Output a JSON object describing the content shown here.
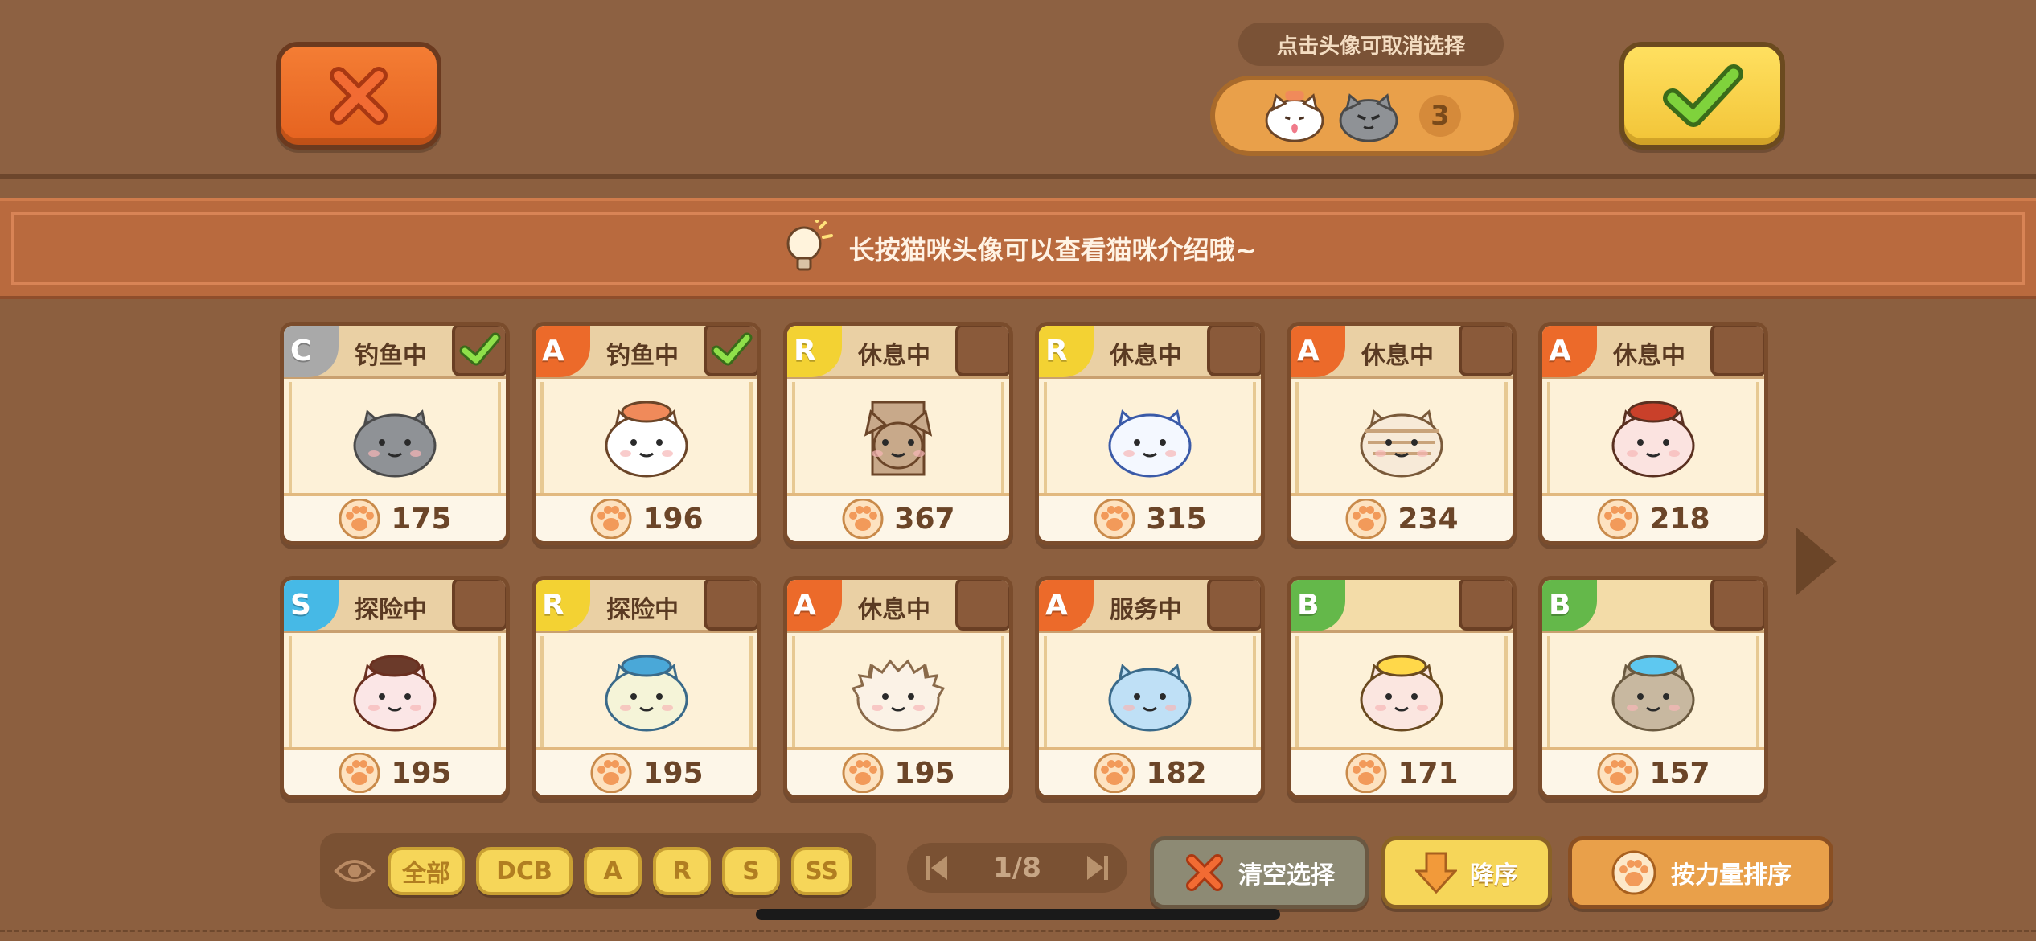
{
  "header": {
    "cancel_hint": "点击头像可取消选择",
    "selected_count": "3"
  },
  "tip": {
    "text": "长按猫咪头像可以查看猫咪介绍哦~"
  },
  "rank_colors": {
    "C": "#a9a9a9",
    "A": "#ec6a2a",
    "R": "#f3d233",
    "S": "#46b9e6",
    "B": "#64b84a"
  },
  "cats": [
    {
      "rank": "C",
      "status": "钓鱼中",
      "power": "175",
      "selected": true,
      "cat": "grey-cat"
    },
    {
      "rank": "A",
      "status": "钓鱼中",
      "power": "196",
      "selected": true,
      "cat": "white-sushi-cat"
    },
    {
      "rank": "R",
      "status": "休息中",
      "power": "367",
      "selected": false,
      "cat": "paper-bag-cat"
    },
    {
      "rank": "R",
      "status": "休息中",
      "power": "315",
      "selected": false,
      "cat": "blue-white-cat"
    },
    {
      "rank": "A",
      "status": "休息中",
      "power": "234",
      "selected": false,
      "cat": "mummy-cat"
    },
    {
      "rank": "A",
      "status": "休息中",
      "power": "218",
      "selected": false,
      "cat": "red-hat-cat"
    },
    {
      "rank": "S",
      "status": "探险中",
      "power": "195",
      "selected": false,
      "cat": "golden-horn-cat"
    },
    {
      "rank": "R",
      "status": "探险中",
      "power": "195",
      "selected": false,
      "cat": "taptap-hat-cat"
    },
    {
      "rank": "A",
      "status": "休息中",
      "power": "195",
      "selected": false,
      "cat": "fluffy-cat"
    },
    {
      "rank": "A",
      "status": "服务中",
      "power": "182",
      "selected": false,
      "cat": "light-blue-cat"
    },
    {
      "rank": "B",
      "status": "",
      "power": "171",
      "selected": false,
      "cat": "blonde-cat"
    },
    {
      "rank": "B",
      "status": "",
      "power": "157",
      "selected": false,
      "cat": "party-hat-cat"
    }
  ],
  "filters": [
    "全部",
    "DCB",
    "A",
    "R",
    "S",
    "SS"
  ],
  "pager": {
    "label": "1/8"
  },
  "toolbar": {
    "clear_label": "清空选择",
    "sort_label": "降序",
    "power_sort_label": "按力量排序"
  }
}
